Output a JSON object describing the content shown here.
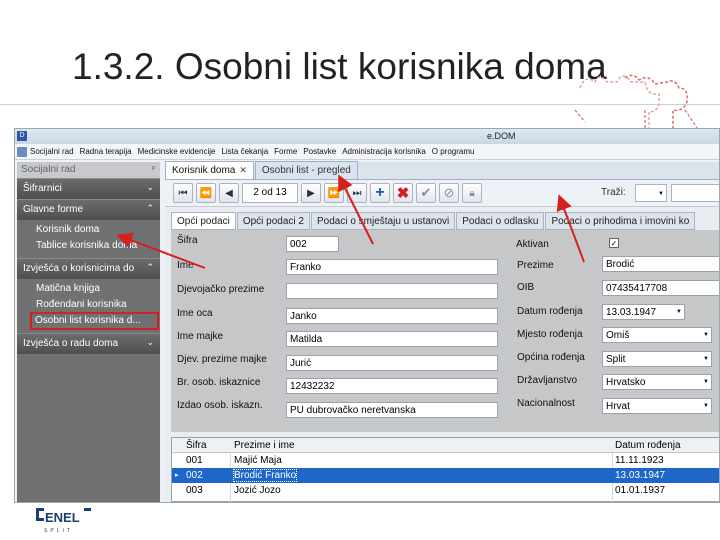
{
  "slide": {
    "title": "1.3.2. Osobni list korisnika doma"
  },
  "window": {
    "app_icon": "D",
    "title": "e.DOM"
  },
  "menu": [
    "Socijalni rad",
    "Radna terapija",
    "Medicinske evidencije",
    "Lista čekanja",
    "Forme",
    "Postavke",
    "Administracija korisnika",
    "O programu"
  ],
  "sidebar": {
    "header": "Socijalni rad",
    "groups": [
      {
        "label": "Šifrarnici",
        "expanded": false,
        "items": []
      },
      {
        "label": "Glavne forme",
        "expanded": true,
        "items": [
          "Korisnik doma",
          "Tablice korisnika doma"
        ]
      },
      {
        "label": "Izvješća o korisnicima do",
        "expanded": true,
        "items": [
          "Matična knjiga",
          "Rođendani korisnika",
          "Osobni list korisnika d..."
        ]
      },
      {
        "label": "Izvješća o radu doma",
        "expanded": false,
        "items": []
      }
    ],
    "selected_item": "Osobni list korisnika d..."
  },
  "doc_tabs": [
    {
      "label": "Korisnik doma",
      "closable": true,
      "active": true
    },
    {
      "label": "Osobni list - pregled",
      "closable": false,
      "active": false
    }
  ],
  "toolbar": {
    "pager": "2 od 13",
    "search_label": "Traži:",
    "search_value": ""
  },
  "form_tabs": [
    "Opći podaci",
    "Opći podaci 2",
    "Podaci o smještaju u ustanovi",
    "Podaci o odlasku",
    "Podaci o prihodima i imovini ko"
  ],
  "form": {
    "sifra_label": "Šifra",
    "sifra": "002",
    "ime_label": "Ime",
    "ime": "Franko",
    "djevojacko_label": "Djevojačko prezime",
    "djevojacko": "",
    "ime_oca_label": "Ime oca",
    "ime_oca": "Janko",
    "ime_majke_label": "Ime majke",
    "ime_majke": "Matilda",
    "djev_majke_label": "Djev. prezime majke",
    "djev_majke": "Jurić",
    "br_osob_label": "Br. osob. iskaznice",
    "br_osob": "12432232",
    "izdao_label": "Izdao osob. iskazn.",
    "izdao": "PU dubrovačko neretvanska",
    "aktivan_label": "Aktivan",
    "aktivan": true,
    "prezime_label": "Prezime",
    "prezime": "Brodić",
    "oib_label": "OIB",
    "oib": "07435417708",
    "datum_label": "Datum rođenja",
    "datum": "13.03.1947",
    "mjesto_label": "Mjesto rođenja",
    "mjesto": "Omiš",
    "opcina_label": "Općina rođenja",
    "opcina": "Split",
    "drzavljanstvo_label": "Državljanstvo",
    "drzavljanstvo": "Hrvatsko",
    "nacionalnost_label": "Nacionalnost",
    "nacionalnost": "Hrvat"
  },
  "grid": {
    "columns": [
      "Šifra",
      "Prezime i ime",
      "Datum rođenja"
    ],
    "rows": [
      {
        "sifra": "001",
        "ime": "Majić Maja",
        "datum": "11.11.1923",
        "selected": false
      },
      {
        "sifra": "002",
        "ime": "Brodić Franko",
        "datum": "13.03.1947",
        "selected": true
      },
      {
        "sifra": "003",
        "ime": "Jozić Jozo",
        "datum": "01.01.1937",
        "selected": false
      }
    ]
  },
  "colors": {
    "accent": "#1f66c9",
    "annotation": "#d62020",
    "sidebar": "#6f7173"
  },
  "logo": {
    "text": "ENEL",
    "subtext": "SPLIT"
  }
}
